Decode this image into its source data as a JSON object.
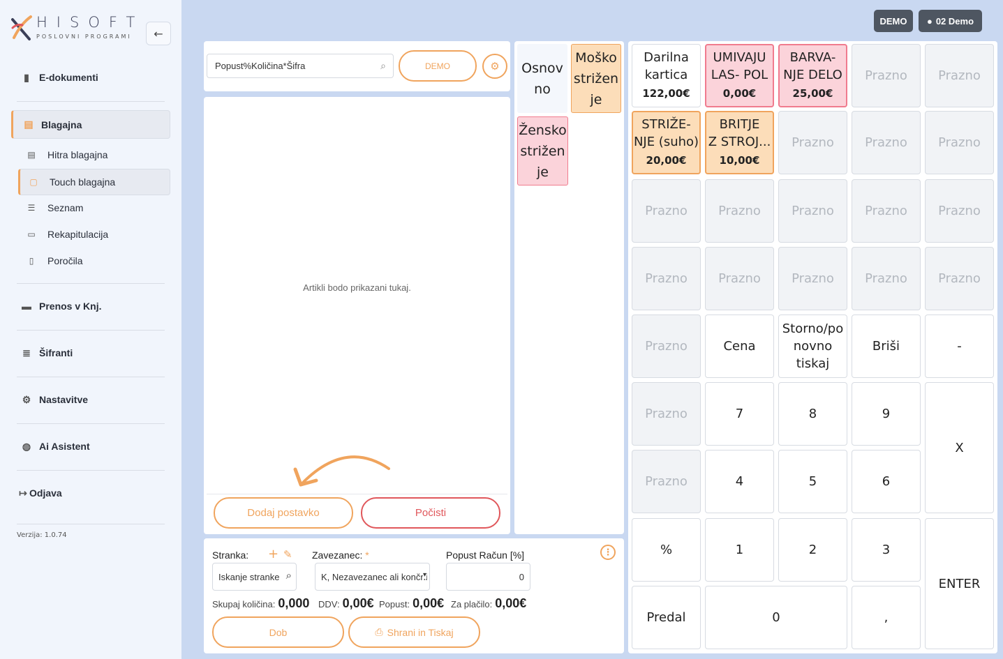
{
  "brand": {
    "name": "HISOFT",
    "tagline": "POSLOVNI PROGRAMI",
    "accent": "#f0a45d"
  },
  "sidebar": {
    "items": [
      {
        "label": "E-dokumenti",
        "icon": "file-icon"
      },
      {
        "label": "Blagajna",
        "icon": "cash-register-icon"
      },
      {
        "label": "Prenos v Knj.",
        "icon": "book-icon"
      },
      {
        "label": "Šifranti",
        "icon": "database-icon"
      },
      {
        "label": "Nastavitve",
        "icon": "gear-icon"
      },
      {
        "label": "Ai Asistent",
        "icon": "brain-icon"
      },
      {
        "label": "Odjava",
        "icon": "logout-icon"
      }
    ],
    "subitems": [
      {
        "label": "Hitra blagajna",
        "icon": "cash-register-icon"
      },
      {
        "label": "Touch blagajna",
        "icon": "tablet-icon"
      },
      {
        "label": "Seznam",
        "icon": "list-icon"
      },
      {
        "label": "Rekapitulacija",
        "icon": "money-icon"
      },
      {
        "label": "Poročila",
        "icon": "report-icon"
      }
    ],
    "version": "Verzija: 1.0.74"
  },
  "topbar": {
    "demo_badge": "DEMO",
    "user_label": "02 Demo"
  },
  "search": {
    "value": "Popust%Količina*Šifra"
  },
  "demo_button": "DEMO",
  "items_panel": {
    "empty_text": "Artikli bodo prikazani tukaj.",
    "add_label": "Dodaj postavko",
    "clear_label": "Počisti"
  },
  "categories": [
    {
      "label": "Osnovno",
      "lines": [
        "Osnov",
        "no"
      ]
    },
    {
      "label": "Moško striženje",
      "lines": [
        "Moško",
        "strižen",
        "je"
      ]
    },
    {
      "label": "Žensko striženje",
      "lines": [
        "Žensko",
        "strižen",
        "je"
      ]
    }
  ],
  "products": [
    {
      "lines": [
        "Darilna",
        "kartica"
      ],
      "price": "122,00€"
    },
    {
      "lines": [
        "UMIVAJU",
        "LAS- POL"
      ],
      "price": "0,00€"
    },
    {
      "lines": [
        "BARVA-",
        "NJE DELO"
      ],
      "price": "25,00€"
    },
    {
      "lines": [
        "STRIŽE-",
        "NJE (suho)"
      ],
      "price": "20,00€"
    },
    {
      "lines": [
        "BRITJE",
        "Z STROJ..."
      ],
      "price": "10,00€"
    }
  ],
  "empty_label": "Prazno",
  "keys": {
    "cena": "Cena",
    "storno": [
      "Storno/po",
      "novno",
      "tiskaj"
    ],
    "brisi": "Briši",
    "minus": "-",
    "k7": "7",
    "k8": "8",
    "k9": "9",
    "x": "X",
    "k4": "4",
    "k5": "5",
    "k6": "6",
    "pct": "%",
    "k1": "1",
    "k2": "2",
    "k3": "3",
    "enter": "ENTER",
    "predal": "Predal",
    "k0": "0",
    "comma": ","
  },
  "form": {
    "stranka_label": "Stranka:",
    "stranka_placeholder": "Iskanje stranke",
    "zavezanec_label": "Zavezanec:",
    "zavezanec_required": "*",
    "zavezanec_value": "K, Nezavezanec ali končni",
    "popust_label": "Popust Račun [%]",
    "popust_value": "0",
    "skupaj_label": "Skupaj količina:",
    "skupaj_value": "0,000",
    "ddv_label": "DDV:",
    "ddv_value": "0,00€",
    "popust_total_label": "Popust:",
    "popust_total_value": "0,00€",
    "placilo_label": "Za plačilo:",
    "placilo_value": "0,00€",
    "dob_label": "Dob",
    "print_label": "Shrani in Tiskaj"
  }
}
